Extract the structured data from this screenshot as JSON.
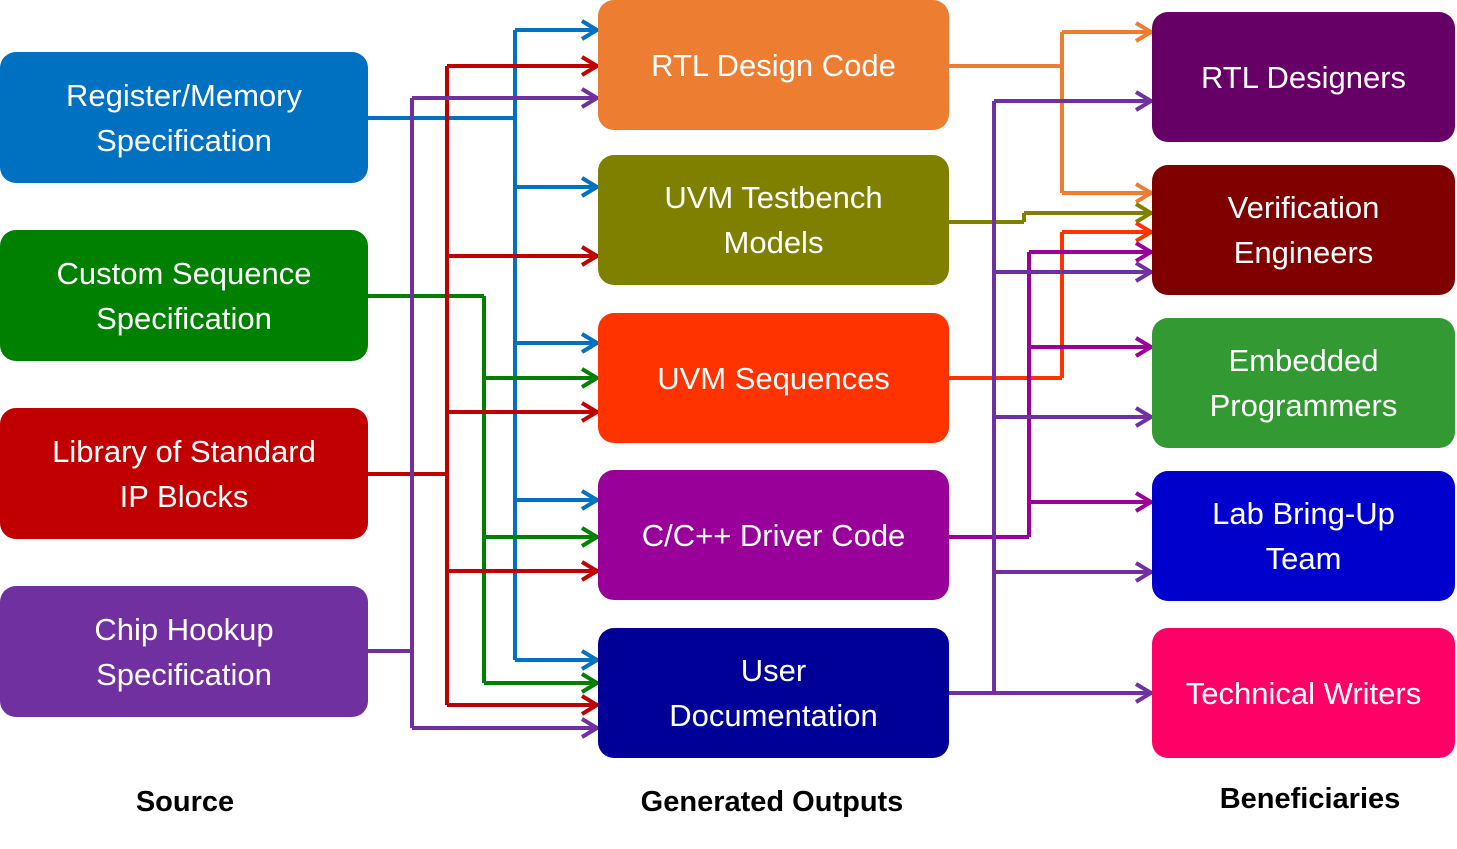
{
  "sources": [
    {
      "label": "Register/Memory\nSpecification",
      "color": "#0070C0"
    },
    {
      "label": "Custom Sequence\nSpecification",
      "color": "#008000"
    },
    {
      "label": "Library of Standard\nIP Blocks",
      "color": "#C00000"
    },
    {
      "label": "Chip Hookup\nSpecification",
      "color": "#7030A0"
    }
  ],
  "outputs": [
    {
      "label": "RTL Design Code",
      "color": "#ED7D31"
    },
    {
      "label": "UVM Testbench\nModels",
      "color": "#808000"
    },
    {
      "label": "UVM Sequences",
      "color": "#FF3300"
    },
    {
      "label": "C/C++ Driver Code",
      "color": "#990099"
    },
    {
      "label": "User\nDocumentation",
      "color": "#000099"
    }
  ],
  "beneficiaries": [
    {
      "label": "RTL Designers",
      "color": "#660066"
    },
    {
      "label": "Verification\nEngineers",
      "color": "#800000"
    },
    {
      "label": "Embedded\nProgrammers",
      "color": "#339933"
    },
    {
      "label": "Lab Bring-Up\nTeam",
      "color": "#0000CC"
    },
    {
      "label": "Technical Writers",
      "color": "#FF0066"
    }
  ],
  "column_labels": {
    "source": "Source",
    "outputs": "Generated Outputs",
    "beneficiaries": "Beneficiaries"
  },
  "source_to_output": [
    {
      "from": 0,
      "to": [
        0,
        1,
        2,
        3,
        4
      ]
    },
    {
      "from": 1,
      "to": [
        2,
        3,
        4
      ]
    },
    {
      "from": 2,
      "to": [
        0,
        1,
        2,
        3,
        4
      ]
    },
    {
      "from": 3,
      "to": [
        0,
        4
      ]
    }
  ],
  "output_to_beneficiary": [
    {
      "from": 0,
      "to": [
        0,
        1
      ]
    },
    {
      "from": 1,
      "to": [
        1
      ]
    },
    {
      "from": 2,
      "to": [
        1
      ]
    },
    {
      "from": 3,
      "to": [
        1,
        2,
        3
      ]
    },
    {
      "from": 4,
      "to": [
        0,
        1,
        2,
        3,
        4
      ]
    }
  ],
  "edge_colors": {
    "output_0": "#ED7D31",
    "output_1": "#808000",
    "output_2": "#FF3300",
    "output_3": "#990099",
    "output_4": "#7030A0"
  }
}
